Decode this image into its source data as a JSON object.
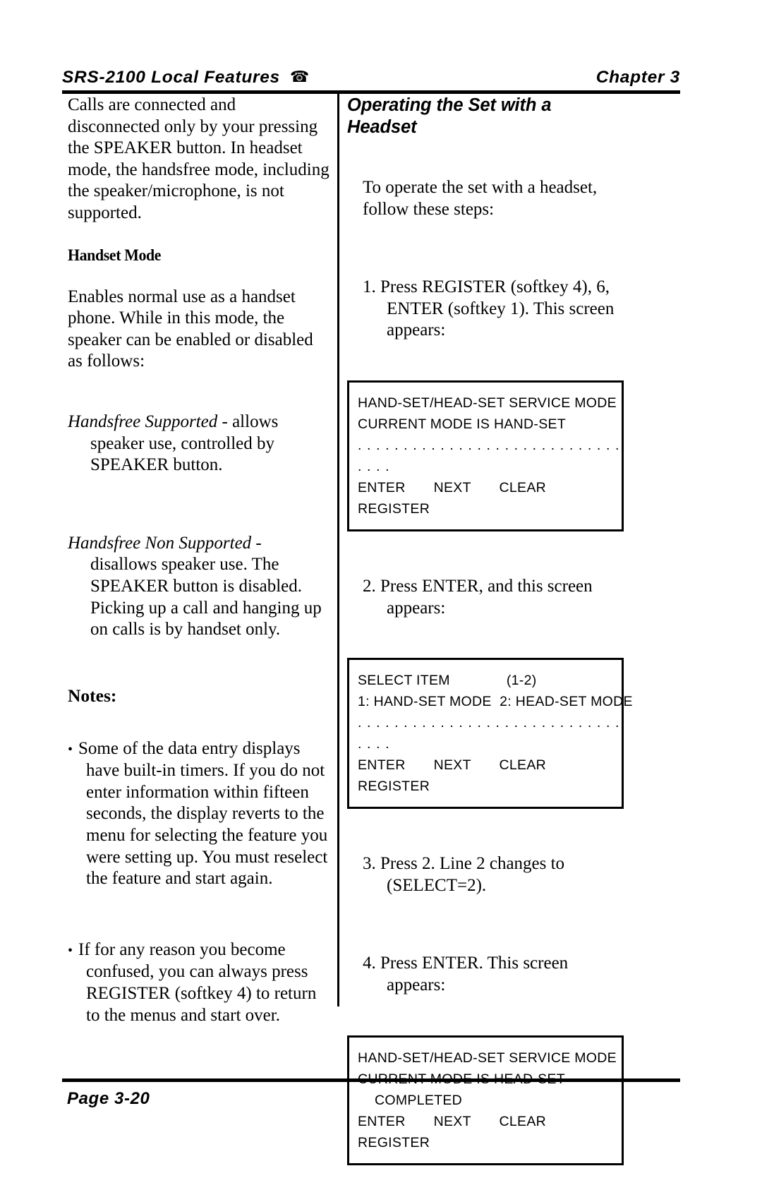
{
  "header": {
    "title": "SRS-2100 Local Features",
    "phone_icon": "☎",
    "chapter": "Chapter 3"
  },
  "left_column": {
    "intro_paragraph": "Calls are connected and disconnected only by your pressing the SPEAKER button.  In headset mode, the handsfree mode, including the speaker/microphone, is not supported.",
    "handset_mode_heading": "Handset Mode",
    "handset_mode_paragraph": "Enables normal use as a handset phone.  While in this mode, the speaker can be enabled or disabled as follows:",
    "definitions": [
      {
        "term": "Handsfree Supported",
        "text": " - allows speaker use, controlled by SPEAKER button."
      },
      {
        "term": "Handsfree Non Supported",
        "text": " - disallows speaker use.  The SPEAKER button is disabled.  Picking up a call and hanging up on calls is by handset only."
      }
    ],
    "notes_heading": "Notes:",
    "notes_bullet_glyph": "•",
    "notes": [
      "Some of the data entry displays have built-in timers.  If you do not enter information within fifteen seconds, the display reverts to the menu for selecting the feature you were setting up.  You must reselect the feature and start again.",
      "If for any reason you become confused, you can always press REGISTER (softkey 4) to return to the menus and start over."
    ]
  },
  "right_column": {
    "section_heading": "Operating the Set with a Headset",
    "intro_paragraph": "To operate the set with a headset, follow these steps:",
    "steps": [
      {
        "number": "1.",
        "text": "Press REGISTER (softkey 4), 6, ENTER (softkey 1).  This screen appears:"
      },
      {
        "number": "2.",
        "text": "Press ENTER, and this screen appears:"
      },
      {
        "number": "3.",
        "text": "Press 2.  Line 2 changes to (SELECT=2)."
      },
      {
        "number": "4.",
        "text": "Press ENTER.  This screen appears:"
      }
    ],
    "screens": [
      {
        "lines": [
          {
            "text": "HAND-SET/HEAD-SET SERVICE MODE",
            "indent": false,
            "dots": false
          },
          {
            "text": "CURRENT MODE IS HAND-SET",
            "indent": false,
            "dots": false
          },
          {
            "text": ". . . . . . . . . . . . . . . . . . . . . . . . . . . . .",
            "indent": false,
            "dots": true
          },
          {
            "text": ". . . .",
            "indent": false,
            "dots": true
          },
          {
            "text": "ENTER       NEXT       CLEAR",
            "indent": false,
            "dots": false
          },
          {
            "text": "REGISTER",
            "indent": false,
            "dots": false
          }
        ]
      },
      {
        "lines": [
          {
            "text": "SELECT ITEM              (1-2)",
            "indent": false,
            "dots": false
          },
          {
            "text": "1: HAND-SET MODE  2: HEAD-SET MODE",
            "indent": false,
            "dots": false
          },
          {
            "text": ". . . . . . . . . . . . . . . . . . . . . . . . . . . . .",
            "indent": false,
            "dots": true
          },
          {
            "text": ". . . .",
            "indent": false,
            "dots": true
          },
          {
            "text": "ENTER       NEXT       CLEAR",
            "indent": false,
            "dots": false
          },
          {
            "text": "REGISTER",
            "indent": false,
            "dots": false
          }
        ]
      },
      {
        "lines": [
          {
            "text": "HAND-SET/HEAD-SET SERVICE MODE",
            "indent": false,
            "dots": false
          },
          {
            "text": "CURRENT MODE IS HEAD-SET",
            "indent": false,
            "dots": false
          },
          {
            "text": "COMPLETED",
            "indent": true,
            "dots": false
          },
          {
            "text": "ENTER       NEXT       CLEAR",
            "indent": false,
            "dots": false
          },
          {
            "text": "REGISTER",
            "indent": false,
            "dots": false
          }
        ]
      }
    ]
  },
  "footer": {
    "page_label": "Page 3-20"
  }
}
